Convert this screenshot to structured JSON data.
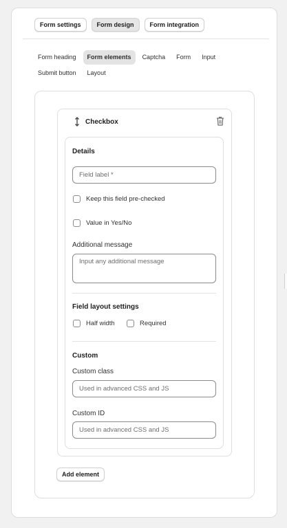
{
  "top_tabs": [
    {
      "label": "Form settings",
      "active": false
    },
    {
      "label": "Form design",
      "active": true
    },
    {
      "label": "Form integration",
      "active": false
    }
  ],
  "sub_tabs": [
    {
      "label": "Form heading",
      "active": false
    },
    {
      "label": "Form elements",
      "active": true
    },
    {
      "label": "Captcha",
      "active": false
    },
    {
      "label": "Form",
      "active": false
    },
    {
      "label": "Input",
      "active": false
    },
    {
      "label": "Submit button",
      "active": false
    },
    {
      "label": "Layout",
      "active": false
    }
  ],
  "element_card": {
    "title": "Checkbox",
    "drag_icon": "drag-handle-icon",
    "delete_icon": "trash-icon"
  },
  "details": {
    "heading": "Details",
    "field_label_placeholder": "Field label *",
    "precheck_label": "Keep this field pre-checked",
    "yesno_label": "Value in Yes/No",
    "additional_message_label": "Additional message",
    "additional_message_placeholder": "Input any additional message"
  },
  "layout_settings": {
    "heading": "Field layout settings",
    "half_width_label": "Half width",
    "required_label": "Required"
  },
  "custom": {
    "heading": "Custom",
    "class_label": "Custom class",
    "class_placeholder": "Used in advanced CSS and JS",
    "id_label": "Custom ID",
    "id_placeholder": "Used in advanced CSS and JS"
  },
  "add_element_label": "Add element",
  "colors": {
    "page_bg": "#f1f1f1",
    "card_bg": "#ffffff",
    "active_tab_bg": "#e6e6e6",
    "input_border": "#8a8a8a"
  }
}
